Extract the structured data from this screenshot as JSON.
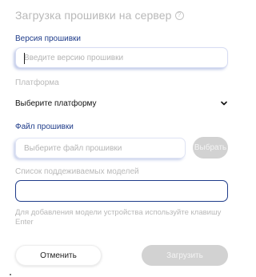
{
  "dialog": {
    "title": "Загрузка прошивки на сервер",
    "help_icon_glyph": "?"
  },
  "version": {
    "label": "Версия прошивки",
    "placeholder": "Введите версию прошивки",
    "value": ""
  },
  "platform": {
    "label": "Платформа",
    "selected": "Выберите платформу"
  },
  "file": {
    "label": "Файл прошивки",
    "placeholder": "Выберите файл прошивки",
    "browse_label": "Выбрать"
  },
  "models": {
    "label": "Список поддеживаемых моделей",
    "value": "",
    "hint": "Для добавления модели устройства используйте клавишу Enter"
  },
  "actions": {
    "cancel_label": "Отменить",
    "upload_label": "Загрузить"
  },
  "colors": {
    "accent": "#1f3c8a",
    "muted_text": "#b9b9b9",
    "disabled_button": "#d2d2d2"
  }
}
